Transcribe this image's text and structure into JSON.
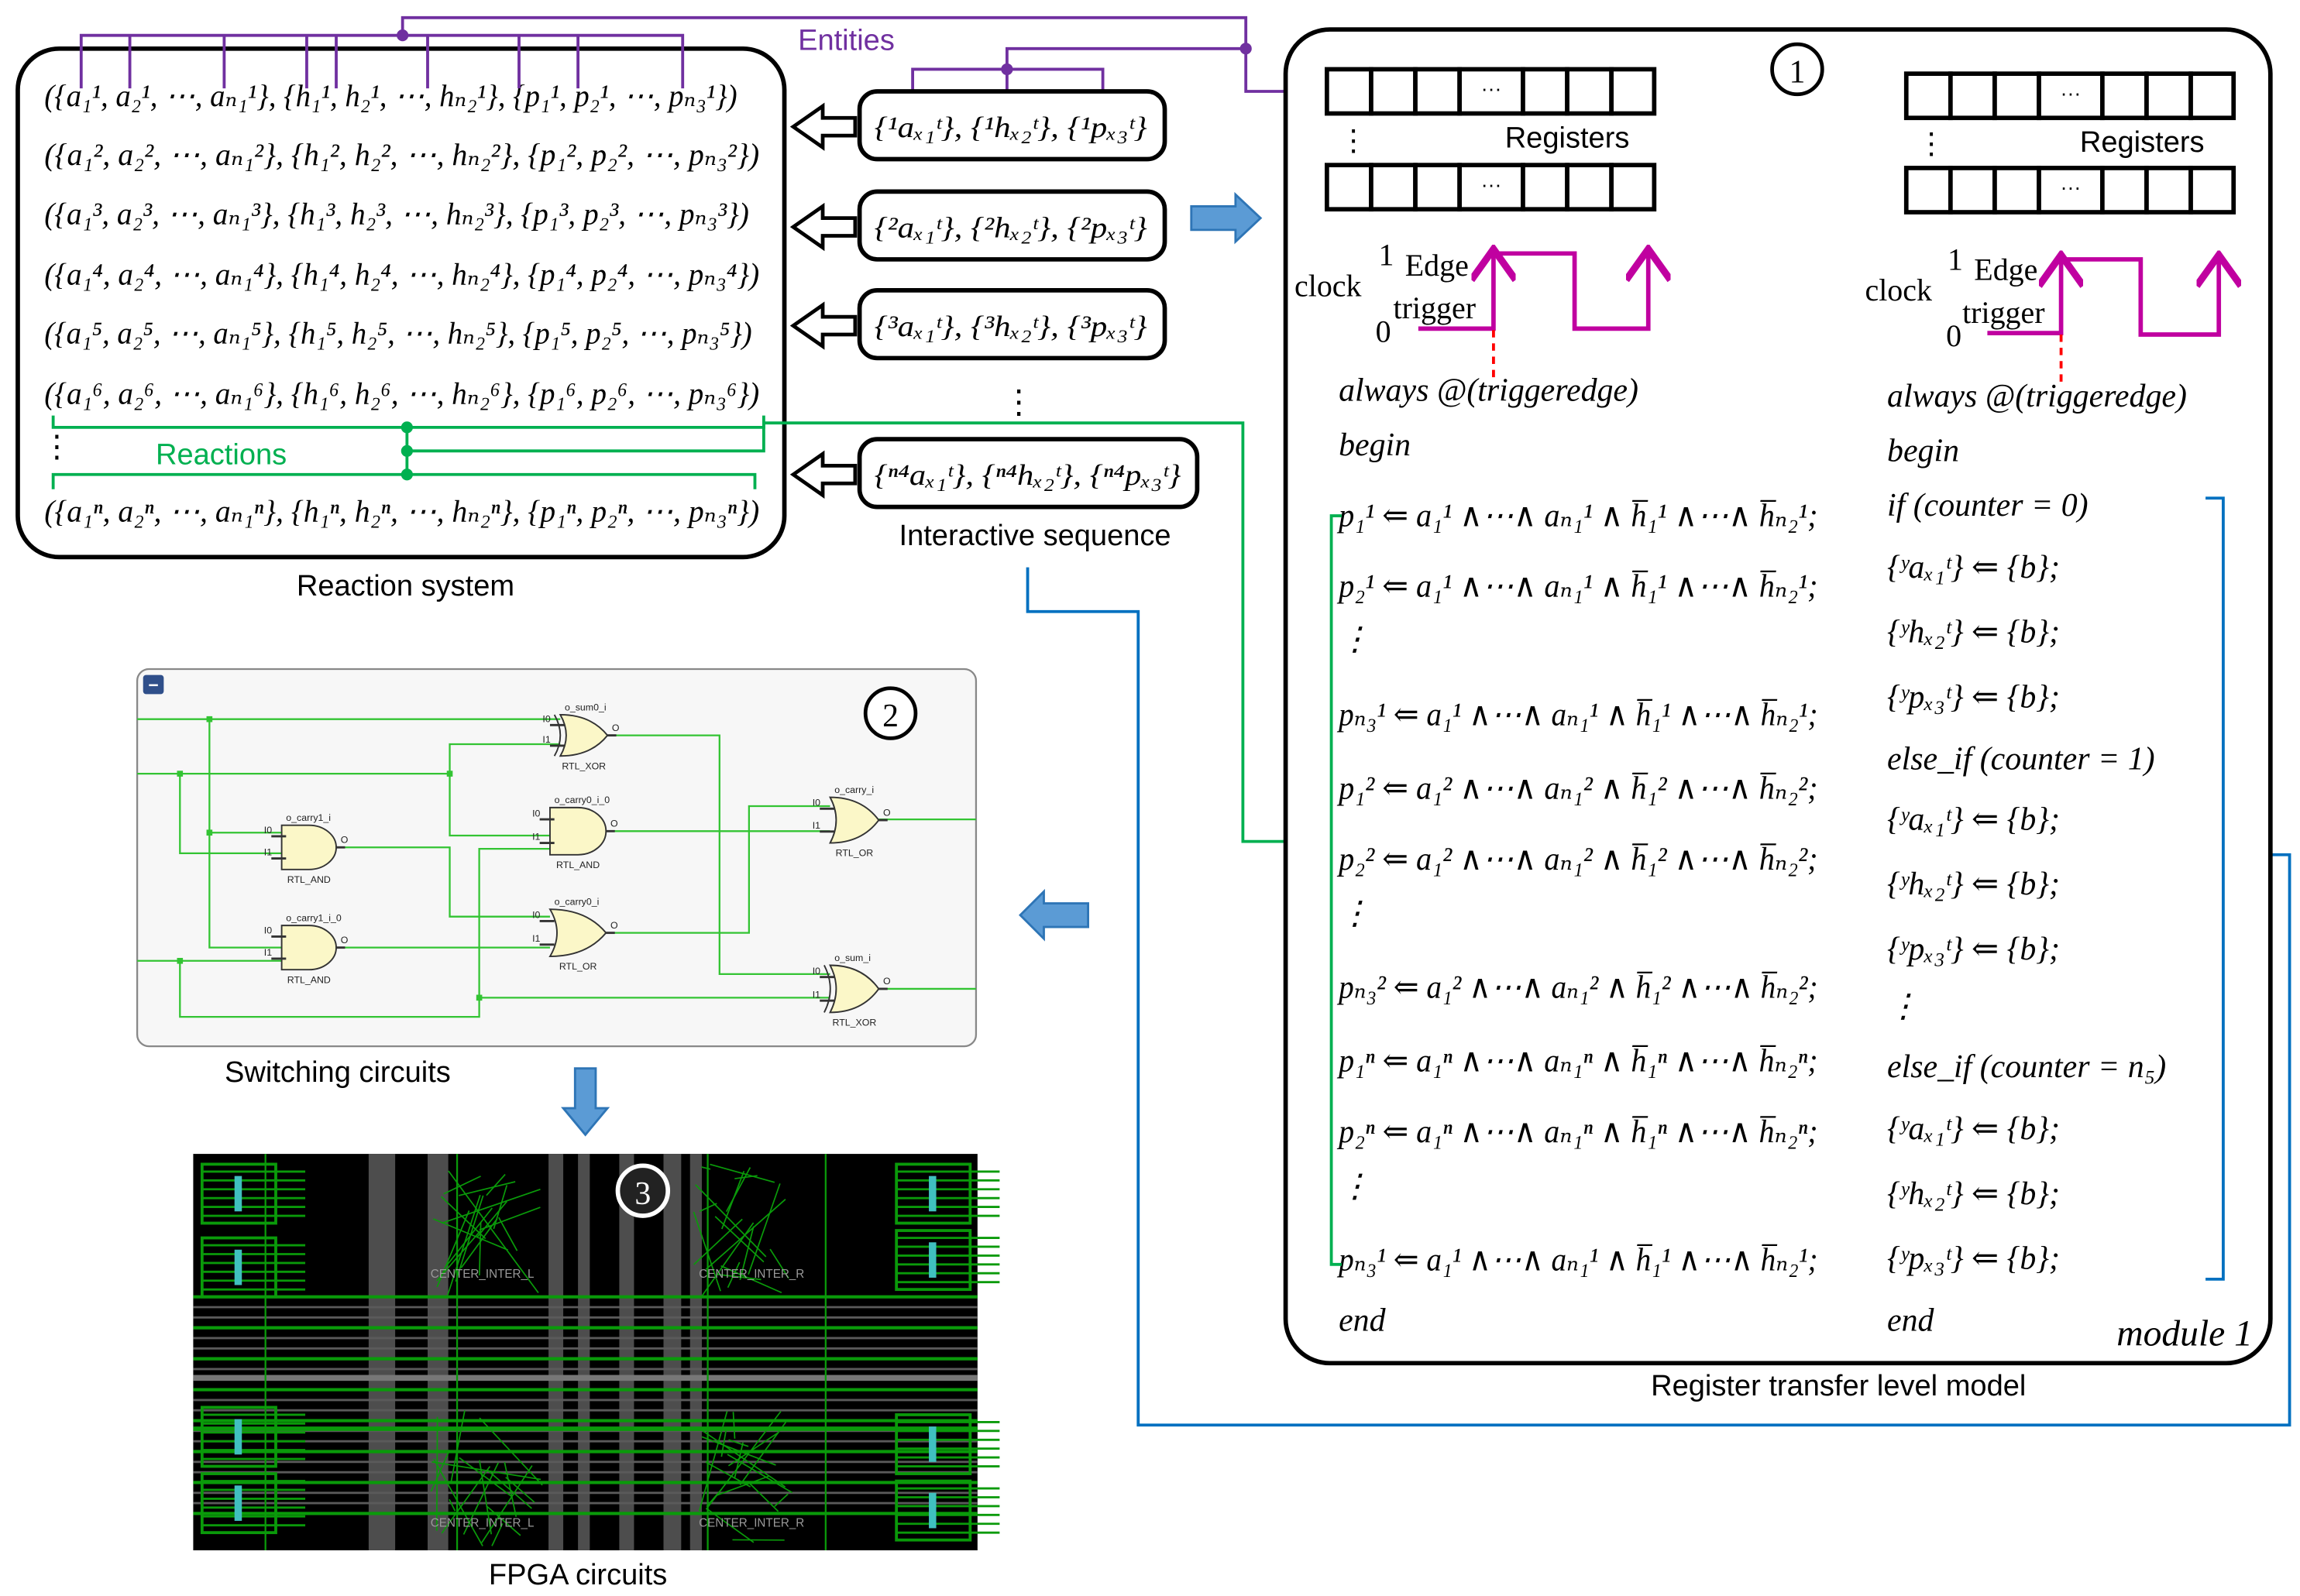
{
  "entities_label": "Entities",
  "reactions_label": "Reactions",
  "reaction_system": {
    "title": "Reaction system",
    "rows": [
      "({a₁¹, a₂¹, ⋯, aₙ₁¹}, {h₁¹, h₂¹, ⋯, hₙ₂¹}, {p₁¹, p₂¹, ⋯, pₙ₃¹})",
      "({a₁², a₂², ⋯, aₙ₁²}, {h₁², h₂², ⋯, hₙ₂²}, {p₁², p₂², ⋯, pₙ₃²})",
      "({a₁³, a₂³, ⋯, aₙ₁³}, {h₁³, h₂³, ⋯, hₙ₂³}, {p₁³, p₂³, ⋯, pₙ₃³})",
      "({a₁⁴, a₂⁴, ⋯, aₙ₁⁴}, {h₁⁴, h₂⁴, ⋯, hₙ₂⁴}, {p₁⁴, p₂⁴, ⋯, pₙ₃⁴})",
      "({a₁⁵, a₂⁵, ⋯, aₙ₁⁵}, {h₁⁵, h₂⁵, ⋯, hₙ₂⁵}, {p₁⁵, p₂⁵, ⋯, pₙ₃⁵})",
      "({a₁⁶, a₂⁶, ⋯, aₙ₁⁶}, {h₁⁶, h₂⁶, ⋯, hₙ₂⁶}, {p₁⁶, p₂⁶, ⋯, pₙ₃⁶})",
      "({a₁ⁿ, a₂ⁿ, ⋯, aₙ₁ⁿ}, {h₁ⁿ, h₂ⁿ, ⋯, hₙ₂ⁿ}, {p₁ⁿ, p₂ⁿ, ⋯, pₙ₃ⁿ})"
    ],
    "ellipsis": "⋮"
  },
  "interactive_sequence": {
    "title": "Interactive sequence",
    "items": [
      "{¹aₓ₁ᵗ}, {¹hₓ₂ᵗ}, {¹pₓ₃ᵗ}",
      "{²aₓ₁ᵗ}, {²hₓ₂ᵗ}, {²pₓ₃ᵗ}",
      "{³aₓ₁ᵗ}, {³hₓ₂ᵗ}, {³pₓ₃ᵗ}",
      "{ⁿ⁴aₓ₁ᵗ}, {ⁿ⁴hₓ₂ᵗ}, {ⁿ⁴pₓ₃ᵗ}"
    ],
    "ellipsis": "⋮"
  },
  "rtl": {
    "title": "Register transfer level model",
    "badge": "1",
    "registers_label": "Registers",
    "register_ellipsis": "···",
    "vertical_ellipsis": "⋮",
    "clock": {
      "label": "clock",
      "high": "1",
      "low": "0",
      "edge": "Edge",
      "trigger": "trigger"
    },
    "left_code": [
      "always @(triggeredge)",
      "begin",
      "p₁¹ ⇐ a₁¹ ∧⋯∧ aₙ₁¹ ∧ h̅₁¹ ∧⋯∧ h̅ₙ₂¹;",
      "p₂¹ ⇐ a₁¹ ∧⋯∧ aₙ₁¹ ∧ h̅₁¹ ∧⋯∧ h̅ₙ₂¹;",
      "⋮",
      "pₙ₃¹ ⇐ a₁¹ ∧⋯∧ aₙ₁¹ ∧ h̅₁¹ ∧⋯∧ h̅ₙ₂¹;",
      "p₁² ⇐ a₁² ∧⋯∧ aₙ₁² ∧ h̅₁² ∧⋯∧ h̅ₙ₂²;",
      "p₂² ⇐ a₁² ∧⋯∧ aₙ₁² ∧ h̅₁² ∧⋯∧ h̅ₙ₂²;",
      "⋮",
      "pₙ₃² ⇐ a₁² ∧⋯∧ aₙ₁² ∧ h̅₁² ∧⋯∧ h̅ₙ₂²;",
      "p₁ⁿ ⇐ a₁ⁿ ∧⋯∧ aₙ₁ⁿ ∧ h̅₁ⁿ ∧⋯∧ h̅ₙ₂ⁿ;",
      "p₂ⁿ ⇐ a₁ⁿ ∧⋯∧ aₙ₁ⁿ ∧ h̅₁ⁿ ∧⋯∧ h̅ₙ₂ⁿ;",
      "⋮",
      "pₙ₃¹ ⇐ a₁¹ ∧⋯∧ aₙ₁¹ ∧ h̅₁¹ ∧⋯∧ h̅ₙ₂¹;",
      "end"
    ],
    "right_code": [
      "always @(triggeredge)",
      "begin",
      "if (counter = 0)",
      "{ʸaₓ₁ᵗ} ⇐ {b};",
      "{ʸhₓ₂ᵗ} ⇐ {b};",
      "{ʸpₓ₃ᵗ} ⇐ {b};",
      "else_if (counter = 1)",
      "{ʸaₓ₁ᵗ} ⇐ {b};",
      "{ʸhₓ₂ᵗ} ⇐ {b};",
      "{ʸpₓ₃ᵗ} ⇐ {b};",
      "⋮",
      "else_if (counter = n₅)",
      "{ʸaₓ₁ᵗ} ⇐ {b};",
      "{ʸhₓ₂ᵗ} ⇐ {b};",
      "{ʸpₓ₃ᵗ} ⇐ {b};",
      "end"
    ],
    "module_label": "module 1"
  },
  "switching": {
    "title": "Switching circuits",
    "badge": "2",
    "collapse_icon": "−",
    "pin_in0": "I0",
    "pin_in1": "I1",
    "pin_out": "O",
    "gates": [
      {
        "name": "o_sum0_i",
        "type": "RTL_XOR"
      },
      {
        "name": "o_carry1_i",
        "type": "RTL_AND"
      },
      {
        "name": "o_carry0_i_0",
        "type": "RTL_AND"
      },
      {
        "name": "o_carry_i",
        "type": "RTL_OR"
      },
      {
        "name": "o_carry1_i_0",
        "type": "RTL_AND"
      },
      {
        "name": "o_carry0_i",
        "type": "RTL_OR"
      },
      {
        "name": "o_sum_i",
        "type": "RTL_XOR"
      }
    ]
  },
  "fpga": {
    "title": "FPGA circuits",
    "badge": "3",
    "regions": [
      "CENTER_INTER_L",
      "CENTER_INTER_R",
      "CENTER_INTER_L",
      "CENTER_INTER_R"
    ]
  },
  "colors": {
    "entities": "#7030a0",
    "reactions": "#00b050",
    "feedback": "#0070c0",
    "clock": "#c000a0",
    "trigger_marker": "#ff0000",
    "flow_arrow": "#5b9bd5"
  }
}
